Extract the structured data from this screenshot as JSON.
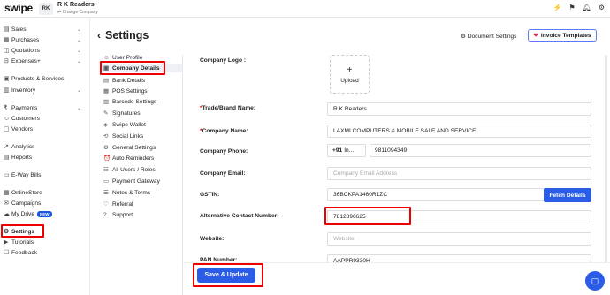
{
  "app": {
    "logo": "swipe",
    "avatar": "RK",
    "business_name": "R K Readers",
    "change_company": "⇄ Change Company"
  },
  "sidebar": [
    {
      "icon": "▤",
      "label": "Sales",
      "chev": "⌄"
    },
    {
      "icon": "▦",
      "label": "Purchases",
      "chev": "⌄"
    },
    {
      "icon": "◫",
      "label": "Quotations",
      "chev": "⌄"
    },
    {
      "icon": "⊟",
      "label": "Expenses+",
      "chev": "⌄"
    },
    {
      "icon": "▣",
      "label": "Products & Services",
      "chev": ""
    },
    {
      "icon": "▥",
      "label": "Inventory",
      "chev": "⌄"
    },
    {
      "icon": "₹",
      "label": "Payments",
      "chev": "⌄"
    },
    {
      "icon": "☺",
      "label": "Customers",
      "chev": ""
    },
    {
      "icon": "▢",
      "label": "Vendors",
      "chev": ""
    },
    {
      "icon": "↗",
      "label": "Analytics",
      "chev": ""
    },
    {
      "icon": "▤",
      "label": "Reports",
      "chev": ""
    },
    {
      "icon": "▭",
      "label": "E-Way Bills",
      "chev": ""
    },
    {
      "icon": "▦",
      "label": "OnlineStore",
      "chev": ""
    },
    {
      "icon": "✉",
      "label": "Campaigns",
      "chev": ""
    },
    {
      "icon": "☁",
      "label": "My Drive",
      "chev": "",
      "badge": "NEW"
    },
    {
      "icon": "⚙",
      "label": "Settings",
      "chev": ""
    },
    {
      "icon": "▶",
      "label": "Tutorials",
      "chev": ""
    },
    {
      "icon": "☐",
      "label": "Feedback",
      "chev": ""
    }
  ],
  "header": {
    "back": "‹",
    "title": "Settings",
    "doc_settings": "⚙ Document Settings",
    "invoice_templates": "Invoice Templates"
  },
  "submenu": [
    {
      "icon": "☺",
      "label": "User Profile"
    },
    {
      "icon": "▣",
      "label": "Company Details"
    },
    {
      "icon": "▤",
      "label": "Bank Details"
    },
    {
      "icon": "▦",
      "label": "POS Settings"
    },
    {
      "icon": "▥",
      "label": "Barcode Settings"
    },
    {
      "icon": "✎",
      "label": "Signatures"
    },
    {
      "icon": "◈",
      "label": "Swipe Wallet"
    },
    {
      "icon": "⟲",
      "label": "Social Links"
    },
    {
      "icon": "⚙",
      "label": "General Settings"
    },
    {
      "icon": "⏰",
      "label": "Auto Reminders"
    },
    {
      "icon": "☷",
      "label": "All Users / Roles"
    },
    {
      "icon": "▭",
      "label": "Payment Gateway"
    },
    {
      "icon": "☰",
      "label": "Notes & Terms"
    },
    {
      "icon": "♡",
      "label": "Referral"
    },
    {
      "icon": "?",
      "label": "Support"
    }
  ],
  "form": {
    "logo_label": "Company Logo :",
    "upload_plus": "+",
    "upload_label": "Upload",
    "trade_label": "Trade/Brand Name:",
    "trade_value": "R K Readers",
    "company_label": "Company Name:",
    "company_value": "LAXMI COMPUTERS & MOBILE SALE AND SERVICE",
    "phone_label": "Company Phone:",
    "country_code": "+91",
    "country_suffix": "In...",
    "phone_value": "9811094349",
    "email_label": "Company Email:",
    "email_placeholder": "Company Email Address",
    "gstin_label": "GSTIN:",
    "gstin_value": "36BCKPA1460R1ZC",
    "fetch_button": "Fetch Details",
    "alt_label": "Alternative Contact Number:",
    "alt_value": "7812896625",
    "website_label": "Website:",
    "website_placeholder": "Website",
    "pan_label": "PAN Number:",
    "pan_value": "AAPPR9330H"
  },
  "save_button": "Save & Update",
  "colors": {
    "primary": "#2b5ce6",
    "highlight": "#e00000",
    "heart": "#e0245e"
  }
}
